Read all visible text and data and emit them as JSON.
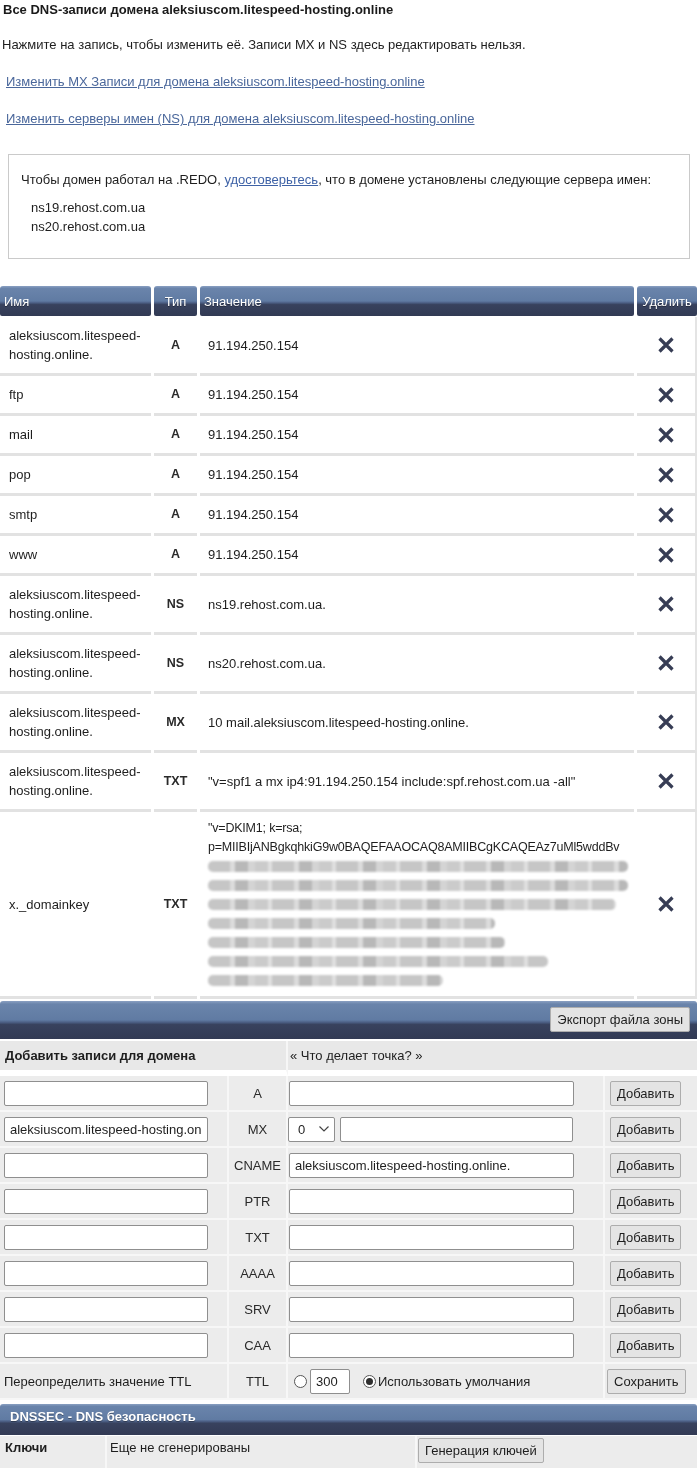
{
  "page": {
    "title": "Все DNS-записи домена aleksiuscom.litespeed-hosting.online",
    "instruction": "Нажмите на запись, чтобы изменить её. Записи MX и NS здесь редактировать нельзя.",
    "links": [
      "Изменить MX Записи для домена aleksiuscom.litespeed-hosting.online",
      "Изменить серверы имен (NS) для домена aleksiuscom.litespeed-hosting.online"
    ]
  },
  "notice": {
    "before": "Чтобы домен работал на .REDO,",
    "link": "удостоверьтесь",
    "after": ", что в домене установлены следующие сервера имен:",
    "nameservers": [
      "ns19.rehost.com.ua",
      "ns20.rehost.com.ua"
    ]
  },
  "records": {
    "columns": [
      "Имя",
      "Тип",
      "Значение",
      "Удалить"
    ],
    "rows": [
      {
        "name": "aleksiuscom.litespeed-hosting.online.",
        "type": "A",
        "value": "91.194.250.154",
        "redacted": false
      },
      {
        "name": "ftp",
        "type": "A",
        "value": "91.194.250.154",
        "redacted": false
      },
      {
        "name": "mail",
        "type": "A",
        "value": "91.194.250.154",
        "redacted": false
      },
      {
        "name": "pop",
        "type": "A",
        "value": "91.194.250.154",
        "redacted": false
      },
      {
        "name": "smtp",
        "type": "A",
        "value": "91.194.250.154",
        "redacted": false
      },
      {
        "name": "www",
        "type": "A",
        "value": "91.194.250.154",
        "redacted": false
      },
      {
        "name": "aleksiuscom.litespeed-hosting.online.",
        "type": "NS",
        "value": "ns19.rehost.com.ua.",
        "redacted": false
      },
      {
        "name": "aleksiuscom.litespeed-hosting.online.",
        "type": "NS",
        "value": "ns20.rehost.com.ua.",
        "redacted": false
      },
      {
        "name": "aleksiuscom.litespeed-hosting.online.",
        "type": "MX",
        "value": "10 mail.aleksiuscom.litespeed-hosting.online.",
        "redacted": false
      },
      {
        "name": "aleksiuscom.litespeed-hosting.online.",
        "type": "TXT",
        "value": "\"v=spf1 a mx ip4:91.194.250.154 include:spf.rehost.com.ua -all\"",
        "redacted": false
      },
      {
        "name": "x._domainkey",
        "type": "TXT",
        "value": "\"v=DKIM1; k=rsa; p=MIIBIjANBgkqhkiG9w0BAQEFAAOCAQ8AMIIBCgKCAQEAz7uMl5wddBv",
        "redacted": true
      }
    ]
  },
  "export_button": "Экспорт файла зоны",
  "add_form": {
    "title": "Добавить записи для домена",
    "help_link": "« Что делает точка? »",
    "rows": [
      {
        "kind": "plain",
        "type": "A",
        "button": "Добавить"
      },
      {
        "kind": "priority",
        "type": "MX",
        "name_value": "aleksiuscom.litespeed-hosting.on",
        "priority": "0",
        "button": "Добавить"
      },
      {
        "kind": "plain",
        "type": "CNAME",
        "target_value": "aleksiuscom.litespeed-hosting.online.",
        "button": "Добавить"
      },
      {
        "kind": "plain",
        "type": "PTR",
        "button": "Добавить"
      },
      {
        "kind": "plain",
        "type": "TXT",
        "button": "Добавить"
      },
      {
        "kind": "plain",
        "type": "AAAA",
        "button": "Добавить"
      },
      {
        "kind": "plain",
        "type": "SRV",
        "button": "Добавить"
      },
      {
        "kind": "plain",
        "type": "CAA",
        "button": "Добавить"
      }
    ],
    "ttl": {
      "label": "Переопределить значение TTL",
      "type": "TTL",
      "options": [
        {
          "kind": "custom",
          "value": "300",
          "selected": false
        },
        {
          "kind": "default",
          "label": "Использовать умолчания",
          "selected": true
        }
      ],
      "button": "Сохранить"
    }
  },
  "dnssec": {
    "title": "DNSSEC - DNS безопасность",
    "keys_label": "Ключи",
    "status": "Еще не сгенерированы",
    "button": "Генерация ключей"
  }
}
